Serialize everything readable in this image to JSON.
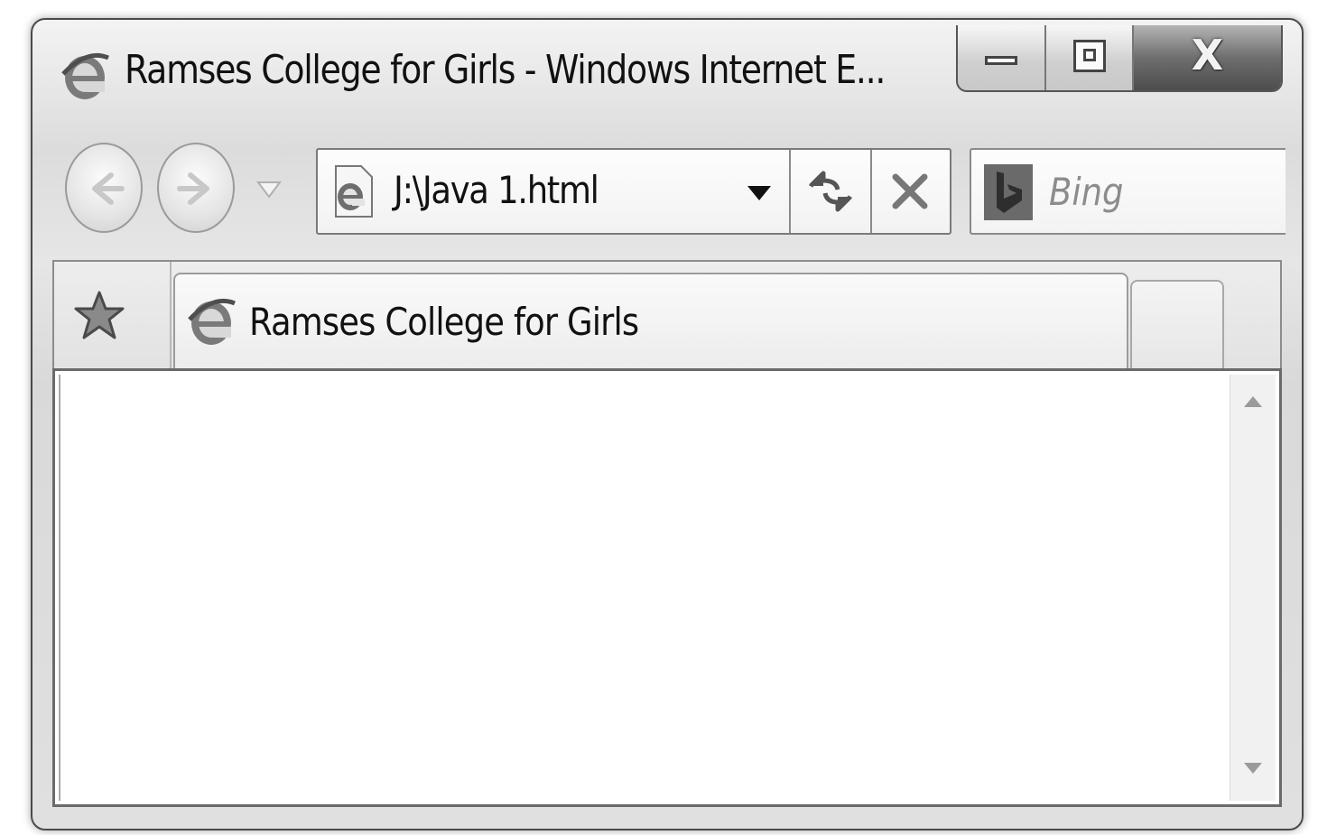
{
  "window": {
    "title": "Ramses College for Girls - Windows Internet E..."
  },
  "caption_buttons": {
    "minimize_icon": "minimize-icon",
    "maximize_icon": "restore-icon",
    "close_label": "X"
  },
  "navigation": {
    "back_icon": "back-arrow-icon",
    "forward_icon": "forward-arrow-icon",
    "history_icon": "dropdown-triangle-icon"
  },
  "address_bar": {
    "value": "J:\\Java 1.html",
    "page_icon": "ie-page-icon",
    "dropdown_icon": "dropdown-arrow-icon",
    "refresh_icon": "refresh-icon",
    "stop_icon": "stop-icon"
  },
  "search": {
    "placeholder": "Bing",
    "provider_icon": "bing-icon"
  },
  "tabs": {
    "favorites_icon": "favorites-star-icon",
    "items": [
      {
        "label": "Ramses College for Girls",
        "icon": "ie-icon",
        "active": true
      }
    ],
    "new_tab_icon": "new-tab"
  },
  "content": {
    "scroll_up_icon": "scroll-up-arrow-icon",
    "scroll_down_icon": "scroll-down-arrow-icon"
  },
  "colors": {
    "chrome_light": "#f3f3f3",
    "chrome_dark": "#d9d9d9",
    "border": "#4a4a4a",
    "close_button": "#5a5a5a",
    "placeholder_text": "#8c8c8c"
  }
}
